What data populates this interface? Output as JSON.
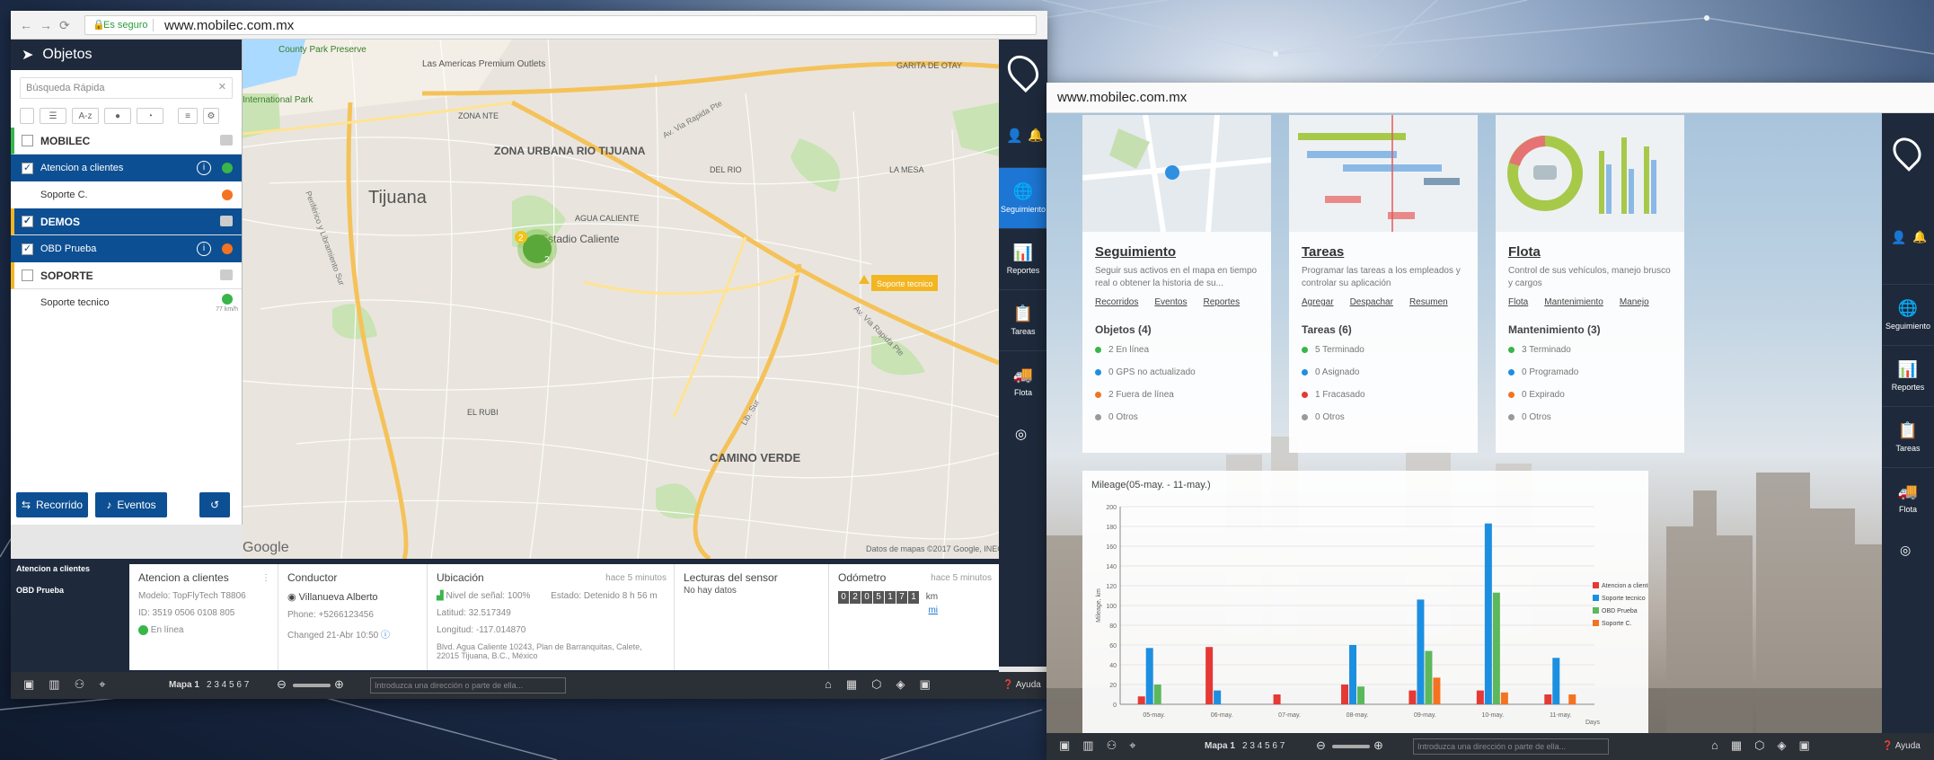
{
  "win1": {
    "secure_label": "Es seguro",
    "url": "www.mobilec.com.mx",
    "panel_title": "Objetos",
    "search_placeholder": "Búsqueda Rápida",
    "sort_label": "A-z",
    "groups": [
      {
        "name": "MOBILEC",
        "items": [
          {
            "name": "Atencion a clientes",
            "selected": true,
            "color": "#39b54a"
          },
          {
            "name": "Soporte C.",
            "selected": false,
            "color": "#f47321"
          }
        ]
      },
      {
        "name": "DEMOS",
        "items": [
          {
            "name": "OBD Prueba",
            "selected": true,
            "color": "#f47321"
          }
        ]
      },
      {
        "name": "SOPORTE",
        "items": [
          {
            "name": "Soporte tecnico",
            "selected": false,
            "color": "#39b54a",
            "speed": "77 km/h"
          }
        ]
      }
    ],
    "btn_recorrido": "Recorrido",
    "btn_eventos": "Eventos",
    "map_labels": {
      "tijuana": "Tijuana",
      "zona_urbana": "ZONA URBANA RIO TIJUANA",
      "camino_verde": "CAMINO VERDE",
      "estadio": "Estadio Caliente",
      "agua_caliente": "AGUA CALIENTE",
      "el_rubi": "EL RUBI",
      "las_americas": "Las Americas Premium Outlets",
      "intl_park": "International Park",
      "county_park": "County Park Preserve",
      "garita": "GARITA DE OTAY",
      "la_mesa": "LA MESA",
      "zona_nte": "ZONA NTE",
      "del_rio": "DEL RIO",
      "soporte_tag": "Soporte tecnico",
      "cluster_a": "2",
      "cluster_b": "2",
      "copyright": "Datos de mapas ©2017 Google, INEGI",
      "google": "Google",
      "road_libramiento": "Periférico y Libramiento Sur",
      "road_rapida": "Av. Via Rapida Pte",
      "road_rapida2": "Av. Via Rapida Pte",
      "road_lib": "Lib. Sur"
    },
    "nav": [
      {
        "label": "Seguimiento",
        "icon": "globe-icon",
        "active": true
      },
      {
        "label": "Reportes",
        "icon": "reports-icon",
        "active": false
      },
      {
        "label": "Tareas",
        "icon": "tasks-icon",
        "active": false
      },
      {
        "label": "Flota",
        "icon": "truck-icon",
        "active": false
      }
    ],
    "vehicle_list": [
      "Atencion a clientes",
      "OBD Prueba"
    ],
    "card_vehicle": {
      "title": "Atencion a clientes",
      "modelo": "Modelo: TopFlyTech T8806",
      "id": "ID: 3519 0506 0108 805",
      "status": "En línea"
    },
    "card_driver": {
      "title": "Conductor",
      "name": "Villanueva Alberto",
      "phone": "Phone: +5266123456",
      "changed": "Changed 21-Abr 10:50"
    },
    "card_location": {
      "title": "Ubicación",
      "ago": "hace 5 minutos",
      "signal": "Nivel de señal: 100%",
      "estado": "Estado: Detenido 8 h 56 m",
      "lat": "Latitud: 32.517349",
      "lon": "Longitud: -117.014870",
      "address": "Blvd. Agua Caliente 10243, Plan de Barranquitas, Calete, 22015 Tijuana, B.C., México"
    },
    "card_sensor": {
      "title": "Lecturas del sensor",
      "value": "No hay datos"
    },
    "card_odo": {
      "title": "Odómetro",
      "ago": "hace 5 minutos",
      "digits": [
        "0",
        "2",
        "0",
        "5",
        "1",
        "7",
        "1"
      ],
      "unit_km": "km",
      "unit_mi": "mi"
    },
    "bottom": {
      "map_label": "Mapa 1",
      "pages": "2 3 4 5 6 7",
      "address_placeholder": "Introduzca una dirección o parte de ella...",
      "help": "Ayuda"
    }
  },
  "win2": {
    "url": "www.mobilec.com.mx",
    "panels": [
      {
        "title": "Seguimiento",
        "desc": "Seguir sus activos en el mapa en tiempo real o obtener la historia de su...",
        "links": [
          "Recorridos",
          "Eventos",
          "Reportes"
        ],
        "subtitle": "Objetos (4)",
        "items": [
          {
            "text": "2 En línea",
            "color": "#39b54a"
          },
          {
            "text": "0 GPS no actualizado",
            "color": "#1d8fe0"
          },
          {
            "text": "2 Fuera de línea",
            "color": "#f47321"
          },
          {
            "text": "0 Otros",
            "color": "#999999"
          }
        ]
      },
      {
        "title": "Tareas",
        "desc": "Programar las tareas a los empleados y controlar su aplicación",
        "links": [
          "Agregar",
          "Despachar",
          "Resumen"
        ],
        "subtitle": "Tareas (6)",
        "items": [
          {
            "text": "5 Terminado",
            "color": "#39b54a"
          },
          {
            "text": "0 Asignado",
            "color": "#1d8fe0"
          },
          {
            "text": "1 Fracasado",
            "color": "#e53935"
          },
          {
            "text": "0 Otros",
            "color": "#999999"
          }
        ]
      },
      {
        "title": "Flota",
        "desc": "Control de sus vehículos, manejo brusco y cargos",
        "links": [
          "Flota",
          "Mantenimiento",
          "Manejo"
        ],
        "subtitle": "Mantenimiento (3)",
        "items": [
          {
            "text": "3 Terminado",
            "color": "#39b54a"
          },
          {
            "text": "0 Programado",
            "color": "#1d8fe0"
          },
          {
            "text": "0 Expirado",
            "color": "#f47321"
          },
          {
            "text": "0 Otros",
            "color": "#999999"
          }
        ]
      }
    ],
    "nav": [
      {
        "label": "Seguimiento",
        "icon": "globe-icon"
      },
      {
        "label": "Reportes",
        "icon": "reports-icon"
      },
      {
        "label": "Tareas",
        "icon": "tasks-icon"
      },
      {
        "label": "Flota",
        "icon": "truck-icon"
      }
    ],
    "bottom": {
      "map_label": "Mapa 1",
      "pages": "2 3 4 5 6 7",
      "address_placeholder": "Introduzca una dirección o parte de ella...",
      "help": "Ayuda"
    }
  },
  "chart_data": {
    "type": "bar",
    "title": "Mileage(05-may. - 11-may.)",
    "ylabel": "Mileage, km",
    "xlabel": "Days",
    "ylim": [
      0,
      200
    ],
    "yticks": [
      0,
      20,
      40,
      60,
      80,
      100,
      120,
      140,
      160,
      180,
      200
    ],
    "categories": [
      "05-may.",
      "06-may.",
      "07-may.",
      "08-may.",
      "09-may.",
      "10-may.",
      "11-may."
    ],
    "series": [
      {
        "name": "Atencion a clientes",
        "color": "#e53935",
        "values": [
          8,
          58,
          10,
          20,
          14,
          14,
          10
        ]
      },
      {
        "name": "Soporte tecnico",
        "color": "#1d8fe0",
        "values": [
          57,
          14,
          0,
          60,
          106,
          183,
          47
        ]
      },
      {
        "name": "OBD Prueba",
        "color": "#5cb85c",
        "values": [
          20,
          0,
          0,
          18,
          54,
          113,
          0
        ]
      },
      {
        "name": "Soporte C.",
        "color": "#f47321",
        "values": [
          0,
          0,
          0,
          0,
          27,
          12,
          10
        ]
      }
    ]
  }
}
